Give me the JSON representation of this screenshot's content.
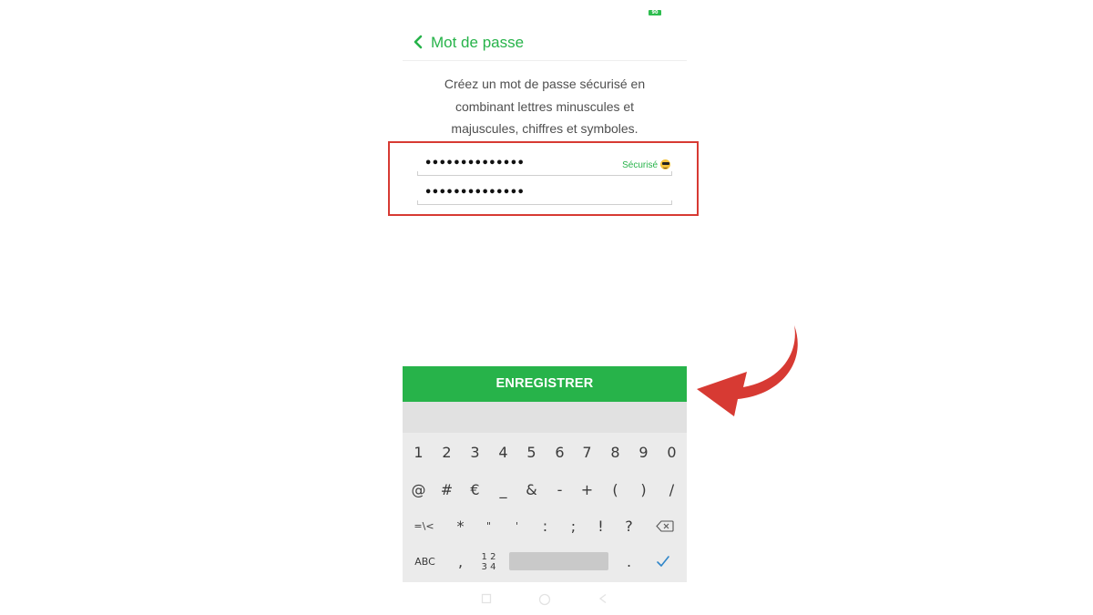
{
  "status_bar": {
    "battery_label": "90"
  },
  "header": {
    "title": "Mot de passe"
  },
  "instructions": "Créez un mot de passe sécurisé en combinant lettres minuscules et majuscules, chiffres et symboles.",
  "password_fields": [
    {
      "value": "••••••••••••••",
      "strength_label": "Sécurisé"
    },
    {
      "value": "••••••••••••••"
    }
  ],
  "save_button": {
    "label": "ENREGISTRER"
  },
  "keyboard": {
    "row1": [
      "1",
      "2",
      "3",
      "4",
      "5",
      "6",
      "7",
      "8",
      "9",
      "0"
    ],
    "row2": [
      "@",
      "#",
      "€",
      "_",
      "&",
      "-",
      "+",
      "(",
      ")",
      "/"
    ],
    "row3": [
      "=\\<",
      "*",
      "\"",
      "'",
      ":",
      ";",
      "!",
      "?"
    ],
    "row4": {
      "abc": "ABC",
      "comma": ",",
      "num_top": "1 2",
      "num_bottom": "3 4",
      "period": "."
    }
  },
  "colors": {
    "accent": "#27b34a",
    "highlight": "#d73a33"
  },
  "icons": [
    "back-icon",
    "emoji-icon",
    "backspace-icon",
    "check-icon",
    "nav-recents-icon",
    "nav-home-icon",
    "nav-back-icon",
    "curved-arrow-icon"
  ]
}
